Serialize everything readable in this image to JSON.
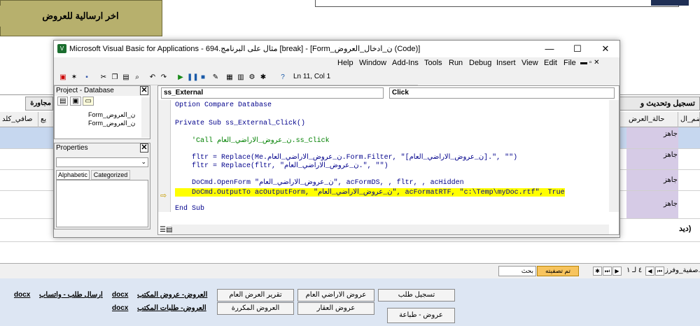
{
  "access_form": {
    "olive_title": "اخر ارسالية للعروض",
    "btn_left": "مجاورة",
    "btn_right": "تسجيل وتحديث و",
    "headers": [
      "صافي_كلد",
      "يع",
      "حالة_العرض",
      "ضم_ال"
    ],
    "cell_status": "جاهز",
    "side_text": "ديد)",
    "nav": {
      "filter_label": "تم تصفيته",
      "search_placeholder": "بحث",
      "record": "٤ لـ ١",
      "left_text": "صفية_وفرز..."
    },
    "buttons": {
      "register_request": "تسجيل طلب",
      "public_land_offers": "عروض الاراضي العام",
      "general_offer_report": "تقرير العرض العام",
      "real_estate_offers": "عروض العقار",
      "repeated_offers": "العروض المكررة",
      "offers_print": "عروض - طباعة"
    },
    "links": {
      "office_offers": "العروض- عروض المكتب",
      "office_offers_doc": "docx",
      "send_request_whatsapp": "ارسال طلب - واتساب",
      "send_request_doc": "docx",
      "office_requests": "العروض- طلبات المكتب",
      "office_requests_doc": "docx"
    }
  },
  "vba": {
    "title": "Microsoft Visual Basic for Applications - 694.مثال على البرنامج [break] - [Form_ن_ادخال_العروض (Code)]",
    "menu": [
      "Help",
      "Window",
      "Add-Ins",
      "Tools",
      "Run",
      "Debug",
      "Insert",
      "View",
      "Edit",
      "File"
    ],
    "status": "Ln 11, Col 1",
    "project_title": "Project - Database",
    "project_items": [
      "Form_ن_العروض",
      "Form_ن_العروض"
    ],
    "properties_title": "Properties",
    "tab_alphabetic": "Alphabetic",
    "tab_categorized": "Categorized",
    "object_combo": "ss_External",
    "proc_combo": "Click",
    "code": [
      "Option Compare Database",
      "",
      "Private Sub ss_External_Click()",
      "",
      "    'Call ن_عروض_الاراضي_العام.ss_Click",
      "",
      "    fltr = Replace(Me.ن_عروض_الاراضي_العام.Form.Filter, \"[ن_عروض_الاراضي_العام].\", \"\")",
      "    fltr = Replace(fltr, \"ن_عروض_الاراضي_العام.\", \"\")",
      "",
      "    DoCmd.OpenForm \"ن_عروض_الاراضي_العام\", acFormDS, , fltr, , acHidden",
      "    DoCmd.OutputTo acOutputForm, \"ن_عروض_الاراضي_العام\", acFormatRTF, \"c:\\Temp\\myDoc.rtf\", True",
      "",
      "End Sub"
    ]
  }
}
